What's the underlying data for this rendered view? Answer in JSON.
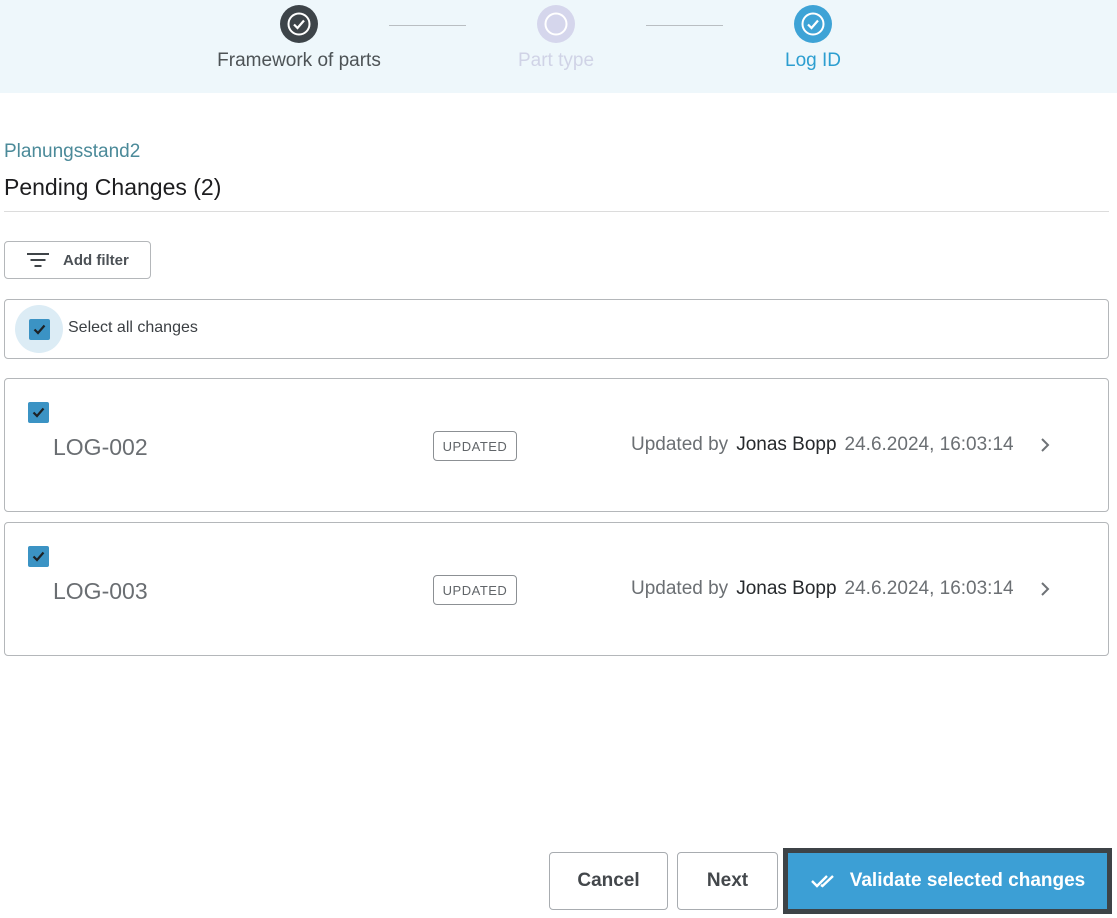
{
  "stepper": {
    "steps": [
      {
        "label": "Framework of parts",
        "state": "completed",
        "icon": "check-circle-icon"
      },
      {
        "label": "Part type",
        "state": "disabled",
        "icon": "circle-icon"
      },
      {
        "label": "Log ID",
        "state": "active-completed",
        "icon": "check-circle-icon"
      }
    ]
  },
  "header": {
    "subtitle": "Planungsstand2",
    "title": "Pending Changes (2)"
  },
  "filter": {
    "label": "Add filter",
    "icon": "filter-icon"
  },
  "select_all": {
    "label": "Select all changes",
    "checked": true
  },
  "changes": [
    {
      "id": "LOG-002",
      "status": "UPDATED",
      "checked": true,
      "by_prefix": "Updated by",
      "user": "Jonas Bopp",
      "date": "24.6.2024, 16:03:14"
    },
    {
      "id": "LOG-003",
      "status": "UPDATED",
      "checked": true,
      "by_prefix": "Updated by",
      "user": "Jonas Bopp",
      "date": "24.6.2024, 16:03:14"
    }
  ],
  "footer": {
    "cancel_label": "Cancel",
    "next_label": "Next",
    "validate_label": "Validate selected changes"
  },
  "colors": {
    "accent": "#3c9fd5",
    "stepper_bg": "#eef7fb",
    "completed_step": "#3d4449",
    "checkbox": "#3b93c4"
  }
}
